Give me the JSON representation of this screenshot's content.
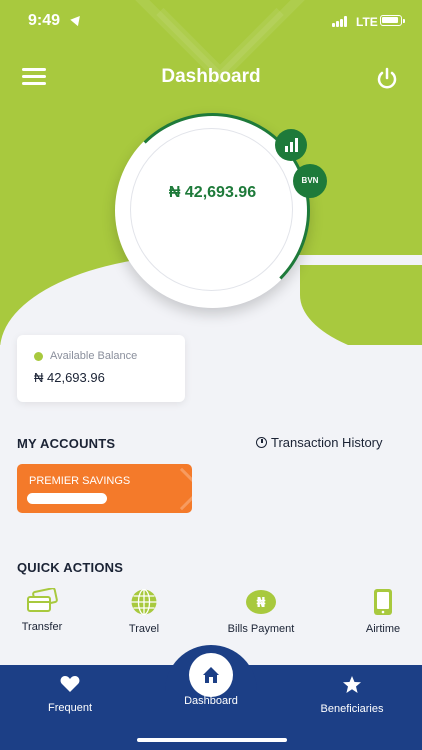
{
  "status_bar": {
    "time": "9:49",
    "network": "LTE"
  },
  "header": {
    "title": "Dashboard"
  },
  "balance_circle": {
    "amount": "₦ 42,693.96",
    "bvn_label": "BVN"
  },
  "available_balance": {
    "label": "Available Balance",
    "value": "₦ 42,693.96"
  },
  "accounts": {
    "title": "MY ACCOUNTS",
    "transaction_history_label": "Transaction History",
    "items": [
      {
        "name": "PREMIER SAVINGS"
      }
    ]
  },
  "quick_actions": {
    "title": "QUICK ACTIONS",
    "items": [
      {
        "label": "Transfer",
        "icon": "card-transfer-icon"
      },
      {
        "label": "Travel",
        "icon": "globe-icon"
      },
      {
        "label": "Bills Payment",
        "icon": "naira-coin-icon"
      },
      {
        "label": "Airtime",
        "icon": "phone-icon"
      }
    ]
  },
  "tabbar": {
    "items": [
      {
        "label": "Frequent",
        "icon": "heart-icon"
      },
      {
        "label": "Dashboard",
        "icon": "home-icon"
      },
      {
        "label": "Beneficiaries",
        "icon": "star-icon"
      }
    ]
  },
  "colors": {
    "brand_green": "#a8c93e",
    "dark_green": "#1e7a3a",
    "navy": "#1c3f86",
    "orange": "#f47a2a"
  }
}
